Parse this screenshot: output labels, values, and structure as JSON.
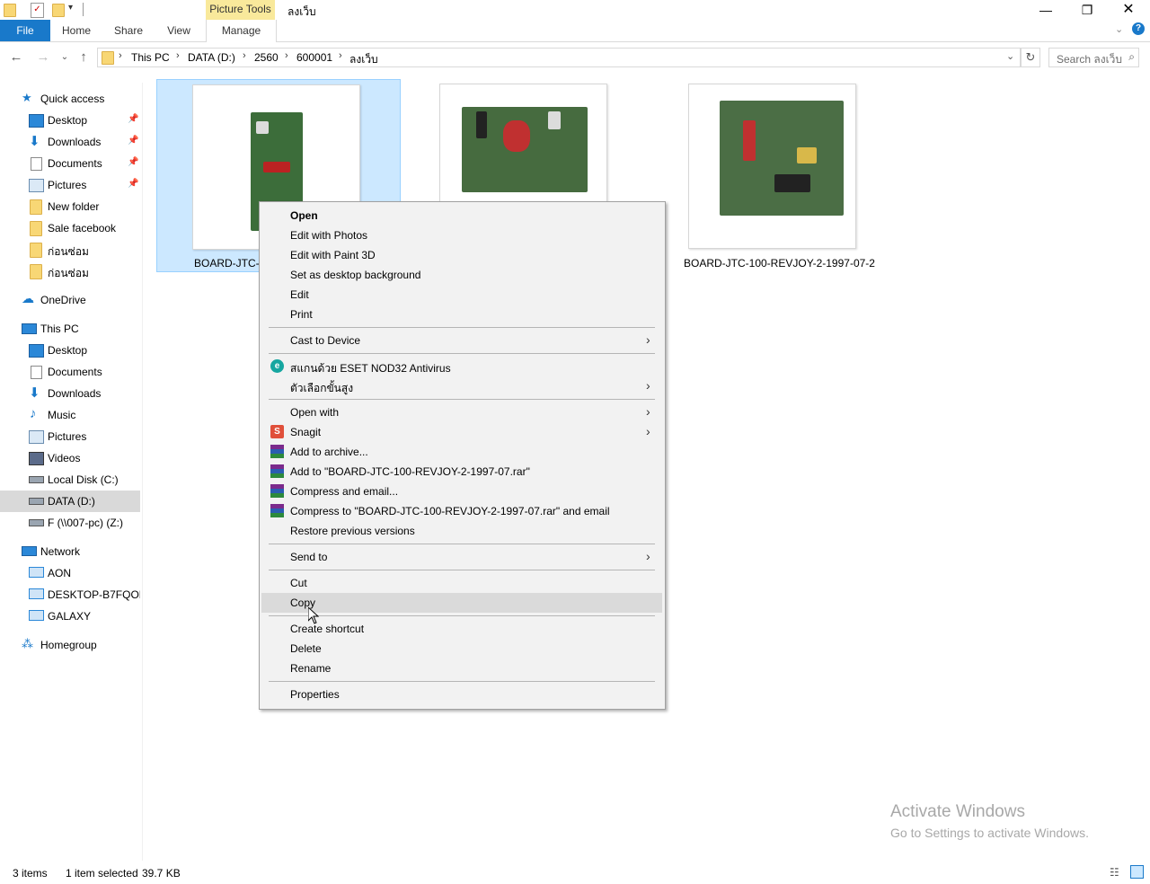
{
  "window": {
    "title": "ลงเว็บ",
    "contextual_tab_group": "Picture Tools",
    "controls": [
      "minimize",
      "restore",
      "close"
    ]
  },
  "ribbon": {
    "tabs": [
      "File",
      "Home",
      "Share",
      "View",
      "Manage"
    ]
  },
  "address": {
    "crumbs": [
      "This PC",
      "DATA (D:)",
      "2560",
      "600001",
      "ลงเว็บ"
    ]
  },
  "search": {
    "placeholder": "Search ลงเว็บ"
  },
  "sidebar": {
    "quick_access": "Quick access",
    "quick_items": [
      {
        "label": "Desktop",
        "icon": "desktop-icon",
        "pinned": true
      },
      {
        "label": "Downloads",
        "icon": "downloads-icon",
        "pinned": true
      },
      {
        "label": "Documents",
        "icon": "documents-icon",
        "pinned": true
      },
      {
        "label": "Pictures",
        "icon": "pictures-icon",
        "pinned": true
      },
      {
        "label": "New folder",
        "icon": "folder-icon",
        "pinned": false
      },
      {
        "label": "Sale facebook",
        "icon": "folder-icon",
        "pinned": false
      },
      {
        "label": "ก่อนซ่อม",
        "icon": "folder-icon",
        "pinned": false
      },
      {
        "label": "ก่อนซ่อม",
        "icon": "folder-icon",
        "pinned": false
      }
    ],
    "onedrive": "OneDrive",
    "this_pc": "This PC",
    "pc_items": [
      {
        "label": "Desktop",
        "icon": "desktop-icon"
      },
      {
        "label": "Documents",
        "icon": "documents-icon"
      },
      {
        "label": "Downloads",
        "icon": "downloads-icon"
      },
      {
        "label": "Music",
        "icon": "music-icon"
      },
      {
        "label": "Pictures",
        "icon": "pictures-icon"
      },
      {
        "label": "Videos",
        "icon": "videos-icon"
      },
      {
        "label": "Local Disk (C:)",
        "icon": "drive-icon"
      },
      {
        "label": "DATA (D:)",
        "icon": "drive-icon",
        "selected": true
      },
      {
        "label": "F (\\\\007-pc) (Z:)",
        "icon": "network-drive-icon"
      }
    ],
    "network": "Network",
    "network_items": [
      {
        "label": "AON",
        "icon": "computer-icon"
      },
      {
        "label": "DESKTOP-B7FQOHI",
        "icon": "computer-icon"
      },
      {
        "label": "GALAXY",
        "icon": "computer-icon"
      }
    ],
    "homegroup": "Homegroup"
  },
  "files": [
    {
      "label": "BOARD-JTC-1",
      "selected": true
    },
    {
      "label": "",
      "selected": false
    },
    {
      "label": "BOARD-JTC-100-REVJOY-2-1997-07-2",
      "selected": false
    }
  ],
  "context_menu": {
    "groups": [
      [
        {
          "label": "Open",
          "bold": true
        },
        {
          "label": "Edit with Photos"
        },
        {
          "label": "Edit with Paint 3D"
        },
        {
          "label": "Set as desktop background"
        },
        {
          "label": "Edit"
        },
        {
          "label": "Print"
        }
      ],
      [
        {
          "label": "Cast to Device",
          "submenu": true
        }
      ],
      [
        {
          "label": "สแกนด้วย ESET NOD32 Antivirus",
          "icon": "eset-icon"
        },
        {
          "label": "ตัวเลือกขั้นสูง",
          "submenu": true
        }
      ],
      [
        {
          "label": "Open with",
          "submenu": true
        },
        {
          "label": "Snagit",
          "icon": "snagit-icon",
          "submenu": true
        },
        {
          "label": "Add to archive...",
          "icon": "winrar-icon"
        },
        {
          "label": "Add to \"BOARD-JTC-100-REVJOY-2-1997-07.rar\"",
          "icon": "winrar-icon"
        },
        {
          "label": "Compress and email...",
          "icon": "winrar-icon"
        },
        {
          "label": "Compress to \"BOARD-JTC-100-REVJOY-2-1997-07.rar\" and email",
          "icon": "winrar-icon"
        },
        {
          "label": "Restore previous versions"
        }
      ],
      [
        {
          "label": "Send to",
          "submenu": true
        }
      ],
      [
        {
          "label": "Cut"
        },
        {
          "label": "Copy",
          "hover": true
        }
      ],
      [
        {
          "label": "Create shortcut"
        },
        {
          "label": "Delete"
        },
        {
          "label": "Rename"
        }
      ],
      [
        {
          "label": "Properties"
        }
      ]
    ]
  },
  "status": {
    "items": "3 items",
    "selection": "1 item selected",
    "size": "39.7 KB"
  },
  "watermark": {
    "line1": "Activate Windows",
    "line2": "Go to Settings to activate Windows."
  }
}
